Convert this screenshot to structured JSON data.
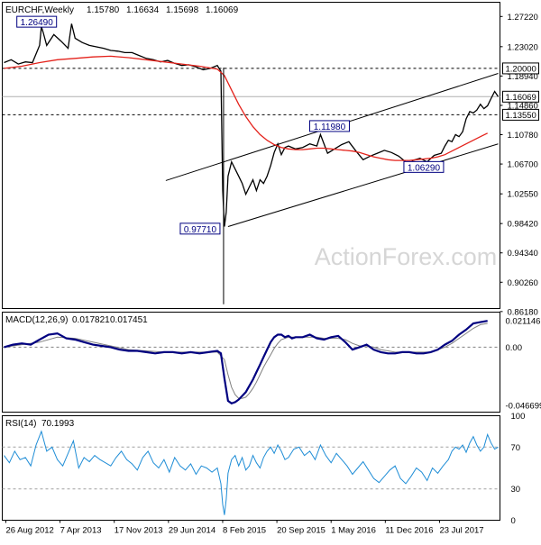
{
  "chart_data": [
    {
      "type": "line",
      "panel": "price",
      "header": {
        "symbol": "EURCHF,Weekly",
        "ohlc": [
          "1.15780",
          "1.16634",
          "1.15698",
          "1.16069"
        ]
      },
      "watermark": "ActionForex.com",
      "ylim": [
        0.866,
        1.292
      ],
      "y_ticks": [
        "1.27220",
        "1.23020",
        "1.18940",
        "1.14860",
        "1.10780",
        "1.06700",
        "1.02550",
        "0.98420",
        "0.94340",
        "0.90260",
        "0.86180"
      ],
      "x_ticks": [
        "26 Aug 2012",
        "7 Apr 2013",
        "17 Nov 2013",
        "29 Jun 2014",
        "8 Feb 2015",
        "20 Sep 2015",
        "1 May 2016",
        "11 Dec 2016",
        "23 Jul 2017"
      ],
      "current_price": {
        "label": "1.16069",
        "value": 1.16069
      },
      "horizontal_levels": [
        {
          "label": "1.20000",
          "value": 1.2
        },
        {
          "label": "1.13550",
          "value": 1.1355
        }
      ],
      "annotations": [
        {
          "label": "1.26490",
          "x": 7.2,
          "y": 1.2649
        },
        {
          "label": "0.97710",
          "x": 123.5,
          "y": 0.9771
        },
        {
          "label": "1.11980",
          "x": 175,
          "y": 1.1198
        },
        {
          "label": "1.06290",
          "x": 228,
          "y": 1.0629
        }
      ],
      "x_range": [
        0,
        278
      ],
      "series": [
        {
          "type": "close",
          "color": "#000000",
          "x": [
            0,
            4,
            8,
            12,
            16,
            20,
            21,
            22,
            24,
            28,
            32,
            36,
            38,
            40,
            44,
            48,
            52,
            56,
            60,
            64,
            68,
            72,
            76,
            80,
            84,
            88,
            92,
            96,
            100,
            104,
            108,
            112,
            116,
            120,
            122,
            123,
            124,
            125,
            126,
            128,
            130,
            132,
            134,
            136,
            138,
            140,
            142,
            144,
            146,
            148,
            150,
            152,
            154,
            156,
            158,
            160,
            164,
            168,
            172,
            176,
            178,
            182,
            186,
            190,
            194,
            198,
            202,
            206,
            210,
            214,
            218,
            222,
            226,
            228,
            230,
            234,
            238,
            242,
            246,
            248,
            250,
            252,
            254,
            256,
            258,
            260,
            262,
            264,
            266,
            268,
            270,
            272,
            274,
            276,
            278
          ],
          "y": [
            1.208,
            1.212,
            1.206,
            1.209,
            1.208,
            1.232,
            1.258,
            1.25,
            1.232,
            1.247,
            1.238,
            1.228,
            1.262,
            1.242,
            1.236,
            1.232,
            1.23,
            1.228,
            1.225,
            1.224,
            1.222,
            1.222,
            1.218,
            1.214,
            1.212,
            1.209,
            1.211,
            1.207,
            1.204,
            1.205,
            1.202,
            1.198,
            1.2,
            1.204,
            1.196,
            1.03,
            0.98,
            1.0,
            1.05,
            1.07,
            1.06,
            1.05,
            1.04,
            1.025,
            1.035,
            1.045,
            1.03,
            1.045,
            1.04,
            1.05,
            1.065,
            1.083,
            1.095,
            1.08,
            1.09,
            1.092,
            1.088,
            1.09,
            1.095,
            1.092,
            1.108,
            1.082,
            1.088,
            1.094,
            1.098,
            1.085,
            1.073,
            1.078,
            1.082,
            1.086,
            1.083,
            1.078,
            1.07,
            1.065,
            1.072,
            1.075,
            1.07,
            1.079,
            1.082,
            1.092,
            1.1,
            1.098,
            1.108,
            1.105,
            1.112,
            1.13,
            1.14,
            1.138,
            1.142,
            1.15,
            1.144,
            1.148,
            1.158,
            1.168,
            1.16069
          ]
        },
        {
          "type": "moving_average",
          "color": "#e4221b",
          "x": [
            0,
            10,
            20,
            30,
            40,
            50,
            60,
            70,
            80,
            90,
            100,
            110,
            120,
            124,
            128,
            132,
            136,
            140,
            144,
            148,
            152,
            156,
            160,
            164,
            168,
            172,
            176,
            180,
            184,
            188,
            192,
            196,
            200,
            204,
            208,
            212,
            216,
            220,
            224,
            228,
            232,
            236,
            240,
            244,
            248,
            252,
            256,
            260,
            264,
            268,
            272
          ],
          "y": [
            1.2,
            1.203,
            1.208,
            1.212,
            1.214,
            1.216,
            1.217,
            1.215,
            1.212,
            1.209,
            1.206,
            1.203,
            1.199,
            1.19,
            1.17,
            1.15,
            1.133,
            1.119,
            1.108,
            1.1,
            1.094,
            1.09,
            1.088,
            1.087,
            1.087,
            1.088,
            1.089,
            1.089,
            1.088,
            1.087,
            1.086,
            1.085,
            1.083,
            1.08,
            1.077,
            1.075,
            1.073,
            1.072,
            1.072,
            1.072,
            1.073,
            1.074,
            1.075,
            1.077,
            1.08,
            1.085,
            1.09,
            1.095,
            1.1,
            1.105,
            1.11
          ]
        }
      ],
      "channel": [
        {
          "x": [
            91,
            278
          ],
          "y": [
            1.044,
            1.193
          ]
        },
        {
          "x": [
            126,
            278
          ],
          "y": [
            0.98,
            1.095
          ]
        }
      ]
    },
    {
      "type": "line",
      "panel": "macd",
      "header": {
        "name": "MACD(12,26,9)",
        "values": [
          "0.017821",
          "0.017451"
        ]
      },
      "ylim": [
        -0.052,
        0.028
      ],
      "y_ticks": [
        "0.021146",
        "0.00",
        "-0.046699"
      ],
      "zero_line": 0,
      "series": [
        {
          "type": "macd",
          "color": "#000080",
          "x": [
            0,
            5,
            10,
            15,
            20,
            25,
            30,
            35,
            40,
            45,
            50,
            55,
            60,
            65,
            70,
            75,
            80,
            85,
            90,
            95,
            100,
            105,
            110,
            115,
            120,
            122,
            124,
            126,
            128,
            130,
            132,
            134,
            136,
            138,
            140,
            142,
            144,
            146,
            148,
            150,
            152,
            154,
            156,
            158,
            160,
            162,
            164,
            168,
            172,
            176,
            180,
            184,
            188,
            192,
            196,
            200,
            204,
            208,
            212,
            216,
            220,
            224,
            228,
            232,
            236,
            240,
            244,
            248,
            252,
            256,
            260,
            264,
            268,
            272
          ],
          "y": [
            0.0,
            0.002,
            0.003,
            0.002,
            0.006,
            0.01,
            0.011,
            0.007,
            0.006,
            0.004,
            0.002,
            0.001,
            0.0,
            -0.002,
            -0.003,
            -0.003,
            -0.004,
            -0.005,
            -0.004,
            -0.004,
            -0.005,
            -0.004,
            -0.005,
            -0.004,
            -0.003,
            -0.005,
            -0.025,
            -0.043,
            -0.045,
            -0.044,
            -0.042,
            -0.039,
            -0.036,
            -0.031,
            -0.026,
            -0.02,
            -0.014,
            -0.008,
            -0.002,
            0.004,
            0.008,
            0.01,
            0.01,
            0.008,
            0.009,
            0.007,
            0.008,
            0.008,
            0.01,
            0.007,
            0.006,
            0.008,
            0.009,
            0.004,
            -0.002,
            0.0,
            0.002,
            -0.002,
            -0.004,
            -0.005,
            -0.005,
            -0.004,
            -0.004,
            -0.005,
            -0.005,
            -0.004,
            -0.002,
            0.002,
            0.005,
            0.01,
            0.014,
            0.019,
            0.02,
            0.021
          ]
        },
        {
          "type": "signal",
          "color": "#808080",
          "x": [
            0,
            10,
            20,
            30,
            40,
            50,
            60,
            70,
            80,
            90,
            100,
            110,
            120,
            124,
            126,
            128,
            130,
            132,
            134,
            136,
            138,
            140,
            142,
            144,
            146,
            148,
            150,
            152,
            154,
            156,
            160,
            164,
            168,
            172,
            176,
            180,
            184,
            188,
            192,
            196,
            200,
            204,
            208,
            212,
            216,
            220,
            224,
            228,
            232,
            236,
            240,
            244,
            248,
            252,
            256,
            260,
            264,
            268,
            272
          ],
          "y": [
            0.0,
            0.002,
            0.004,
            0.008,
            0.007,
            0.004,
            0.001,
            -0.002,
            -0.003,
            -0.004,
            -0.004,
            -0.004,
            -0.004,
            -0.01,
            -0.022,
            -0.032,
            -0.038,
            -0.041,
            -0.041,
            -0.04,
            -0.037,
            -0.033,
            -0.028,
            -0.022,
            -0.016,
            -0.011,
            -0.006,
            -0.001,
            0.003,
            0.006,
            0.008,
            0.008,
            0.008,
            0.008,
            0.008,
            0.007,
            0.007,
            0.007,
            0.006,
            0.003,
            0.001,
            0.001,
            0.0,
            -0.002,
            -0.003,
            -0.004,
            -0.004,
            -0.004,
            -0.004,
            -0.004,
            -0.004,
            -0.002,
            0.0,
            0.003,
            0.007,
            0.011,
            0.015,
            0.018,
            0.019
          ]
        }
      ]
    },
    {
      "type": "line",
      "panel": "rsi",
      "header": {
        "name": "RSI(14)",
        "value": "70.1993"
      },
      "ylim": [
        0,
        100
      ],
      "y_ticks": [
        "100",
        "70",
        "30",
        "0"
      ],
      "levels": [
        70,
        30
      ],
      "series": [
        {
          "type": "rsi",
          "color": "#1f8dd6",
          "x": [
            0,
            3,
            6,
            9,
            12,
            15,
            18,
            21,
            24,
            27,
            30,
            33,
            36,
            39,
            42,
            45,
            48,
            51,
            54,
            57,
            60,
            63,
            66,
            69,
            72,
            75,
            78,
            81,
            84,
            87,
            90,
            93,
            96,
            99,
            102,
            105,
            108,
            111,
            114,
            117,
            120,
            122,
            123,
            124,
            125,
            126,
            128,
            130,
            132,
            134,
            136,
            138,
            140,
            142,
            144,
            146,
            148,
            150,
            152,
            154,
            156,
            158,
            160,
            163,
            166,
            169,
            172,
            175,
            178,
            181,
            184,
            187,
            190,
            193,
            196,
            199,
            202,
            205,
            208,
            211,
            214,
            217,
            220,
            223,
            226,
            229,
            232,
            235,
            238,
            241,
            244,
            247,
            250,
            252,
            254,
            256,
            258,
            260,
            262,
            264,
            266,
            268,
            270,
            272,
            274,
            276,
            278
          ],
          "y": [
            62,
            55,
            66,
            58,
            60,
            52,
            72,
            85,
            66,
            70,
            58,
            52,
            64,
            76,
            50,
            60,
            56,
            62,
            58,
            55,
            52,
            60,
            66,
            58,
            54,
            48,
            60,
            66,
            55,
            50,
            58,
            46,
            60,
            52,
            48,
            54,
            44,
            52,
            50,
            46,
            50,
            35,
            15,
            5,
            20,
            45,
            58,
            62,
            52,
            60,
            48,
            52,
            62,
            55,
            50,
            60,
            66,
            70,
            64,
            72,
            66,
            58,
            60,
            68,
            70,
            62,
            66,
            58,
            72,
            62,
            55,
            64,
            58,
            52,
            44,
            50,
            56,
            48,
            40,
            36,
            42,
            48,
            52,
            40,
            35,
            42,
            50,
            46,
            38,
            50,
            45,
            52,
            58,
            66,
            70,
            68,
            72,
            65,
            74,
            80,
            72,
            66,
            70,
            82,
            74,
            68,
            70
          ]
        }
      ]
    }
  ]
}
